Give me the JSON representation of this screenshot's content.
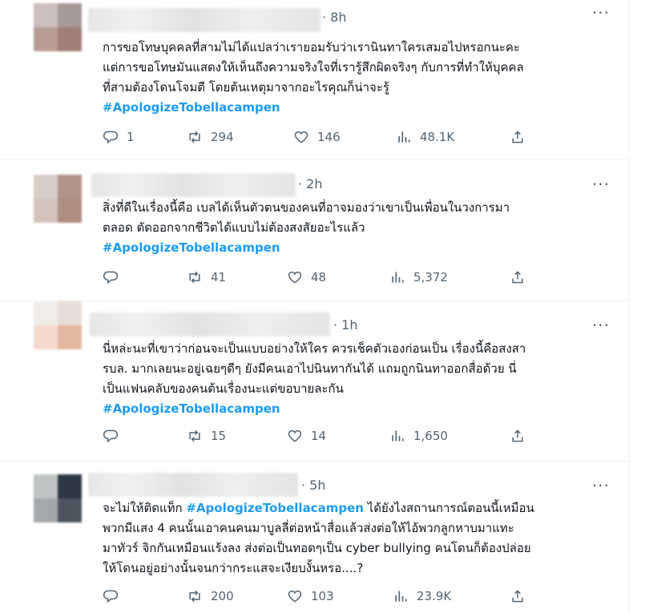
{
  "tweets": [
    {
      "time": "8h",
      "lines": [
        "การขอโทษบุคคลที่สามไม่ได้แปลว่าเรายอมรับว่าเรานินทาใครเสมอไปหรอกนะคะ",
        "แต่การขอโทษมันแสดงให้เห็นถึงความจริงใจที่เรารู้สึกผิดจริงๆ กับการที่ทำให้บุคคล",
        "ที่สามต้องโดนโจมตี โดยต้นเหตุมาจากอะไรคุณก็น่าจะรู้"
      ],
      "hashtag": "#ApologizeTobellacampen",
      "replies": "1",
      "retweets": "294",
      "likes": "146",
      "views": "48.1K"
    },
    {
      "time": "2h",
      "lines": [
        "สิ่งที่ดีในเรื่องนี้คือ เบลได้เห็นตัวตนของคนที่อาจมองว่าเขาเป็นเพื่อนในวงการมา",
        "ตลอด ตัดออกจากชีวิตได้แบบไม่ต้องสงสัยอะไรแล้ว"
      ],
      "hashtag": "#ApologizeTobellacampen",
      "replies": "",
      "retweets": "41",
      "likes": "48",
      "views": "5,372"
    },
    {
      "time": "1h",
      "lines": [
        "นี่หล่ะนะที่เขาว่าก่อนจะเป็นแบบอย่างให้ใคร ควรเช็คตัวเองก่อนเป็น เรื่องนี้คือสงสา",
        "รบล. มากเลยนะอยู่เฉยๆดีๆ ยังมีคนเอาไปนินทากันได้ แถมถูกนินทาออกสื่อด้วย นี่",
        "เป็นแฟนคลับของคนต้นเรื่องนะแต่ขอบายละกัน"
      ],
      "hashtag": "#ApologizeTobellacampen",
      "replies": "",
      "retweets": "15",
      "likes": "14",
      "views": "1,650"
    },
    {
      "time": "5h",
      "prefix": "จะไม่ให้ติดแท็ก ",
      "inline_hashtag": "#ApologizeTobellacampen",
      "suffix": " ได้ยังไงสถานการณ์ตอนนี้เหมือน",
      "lines": [
        "พวกมีแสง 4 คนนั้นเอาคนคนมาบูลลี่ต่อหน้าสื่อแล้วส่งต่อให้ไอ้พวกลูกหาบมาแทะ",
        "มาทัวร์ จิกกันเหมือนแร้งลง ส่งต่อเป็นทอดๆเป็น cyber bullying  คนโดนก็ต้องปล่อย",
        "ให้โดนอยู่อย่างนั้นจนกว่ากระแสจะเงียบงั้นหรอ....?"
      ],
      "replies": "",
      "retweets": "200",
      "likes": "103",
      "views": "23.9K"
    }
  ],
  "icons": {
    "reply": "reply-icon",
    "retweet": "retweet-icon",
    "like": "heart-icon",
    "views": "views-icon",
    "share": "share-icon",
    "more": "more-icon"
  },
  "colors": {
    "hashtag": "#1d9bf0",
    "secondary": "#536471",
    "text": "#0f1419"
  }
}
